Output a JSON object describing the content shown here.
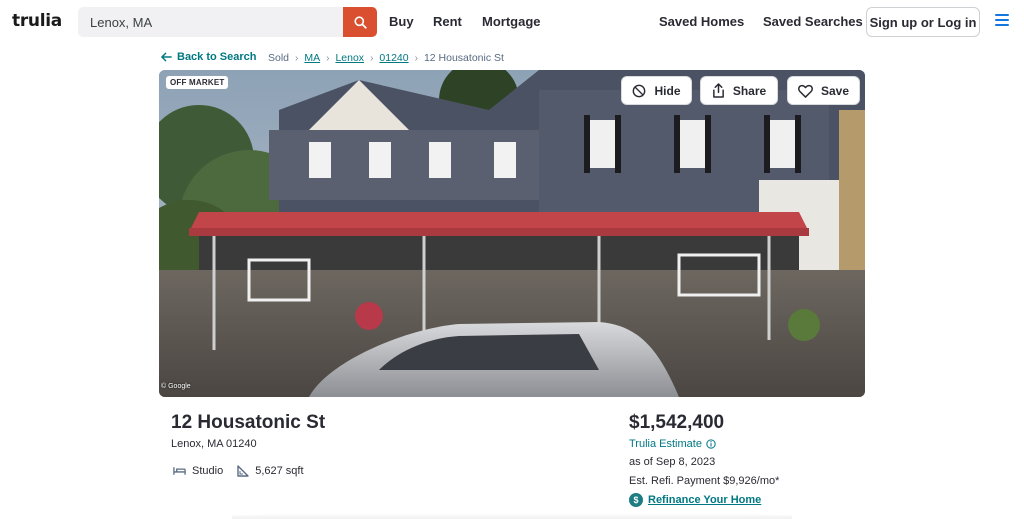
{
  "header": {
    "logo": "trulia",
    "search_value": "Lenox, MA",
    "nav": [
      "Buy",
      "Rent",
      "Mortgage"
    ],
    "saved_homes": "Saved Homes",
    "saved_searches": "Saved Searches",
    "signup": "Sign up or Log in"
  },
  "breadcrumb": {
    "back": "Back to Search",
    "items": [
      "Sold",
      "MA",
      "Lenox",
      "01240",
      "12 Housatonic St"
    ]
  },
  "hero": {
    "badge": "OFF MARKET",
    "hide": "Hide",
    "share": "Share",
    "save": "Save",
    "attribution": "© Google"
  },
  "property": {
    "address": "12 Housatonic St",
    "city": "Lenox, MA 01240",
    "beds": "Studio",
    "sqft": "5,627 sqft",
    "price": "$1,542,400",
    "estimate_label": "Trulia Estimate",
    "as_of": "as of Sep 8, 2023",
    "refi_payment": "Est. Refi. Payment $9,926/mo*",
    "refi_link": "Refinance Your Home"
  },
  "colors": {
    "brand_red": "#d94f30",
    "teal_link": "#007882",
    "menu_blue": "#1277e1"
  },
  "icons": [
    "search-icon",
    "menu-icon",
    "arrow-left-icon",
    "hide-icon",
    "share-icon",
    "heart-icon",
    "bed-icon",
    "sqft-icon",
    "info-icon",
    "dollar-icon"
  ]
}
